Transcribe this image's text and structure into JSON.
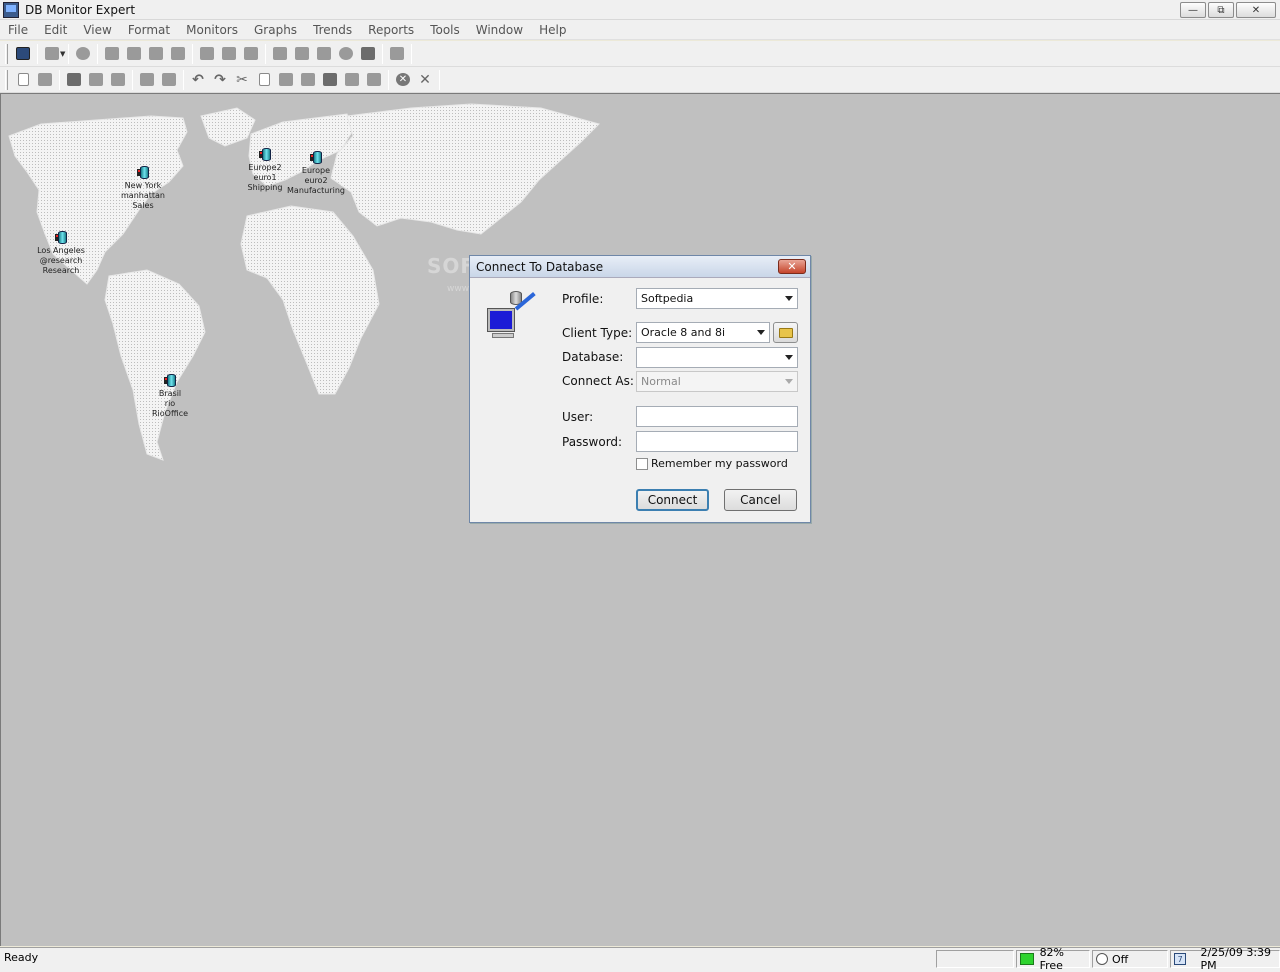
{
  "window": {
    "title": "DB Monitor Expert"
  },
  "menu": [
    "File",
    "Edit",
    "View",
    "Format",
    "Monitors",
    "Graphs",
    "Trends",
    "Reports",
    "Tools",
    "Window",
    "Help"
  ],
  "sites": [
    {
      "lines": [
        "New York",
        "manhattan",
        "Sales"
      ]
    },
    {
      "lines": [
        "Europe2",
        "euro1",
        "Shipping"
      ]
    },
    {
      "lines": [
        "Europe",
        "euro2",
        "Manufacturing"
      ]
    },
    {
      "lines": [
        "Los Angeles",
        "@research",
        "Research"
      ]
    },
    {
      "lines": [
        "Brasil",
        "rio",
        "RioOffice"
      ]
    }
  ],
  "watermark": {
    "text": "SOFTPEDIA",
    "url": "www.softpedia.com"
  },
  "dialog": {
    "title": "Connect To Database",
    "profile_label": "Profile:",
    "profile_value": "Softpedia",
    "client_type_label": "Client Type:",
    "client_type_value": "Oracle 8 and 8i",
    "database_label": "Database:",
    "database_value": "",
    "connect_as_label": "Connect As:",
    "connect_as_value": "Normal",
    "user_label": "User:",
    "password_label": "Password:",
    "remember_label": "Remember my password",
    "connect_button": "Connect",
    "cancel_button": "Cancel"
  },
  "status": {
    "ready": "Ready",
    "memory": "82% Free",
    "timer": "Off",
    "datetime": "2/25/09 3:39 PM"
  }
}
